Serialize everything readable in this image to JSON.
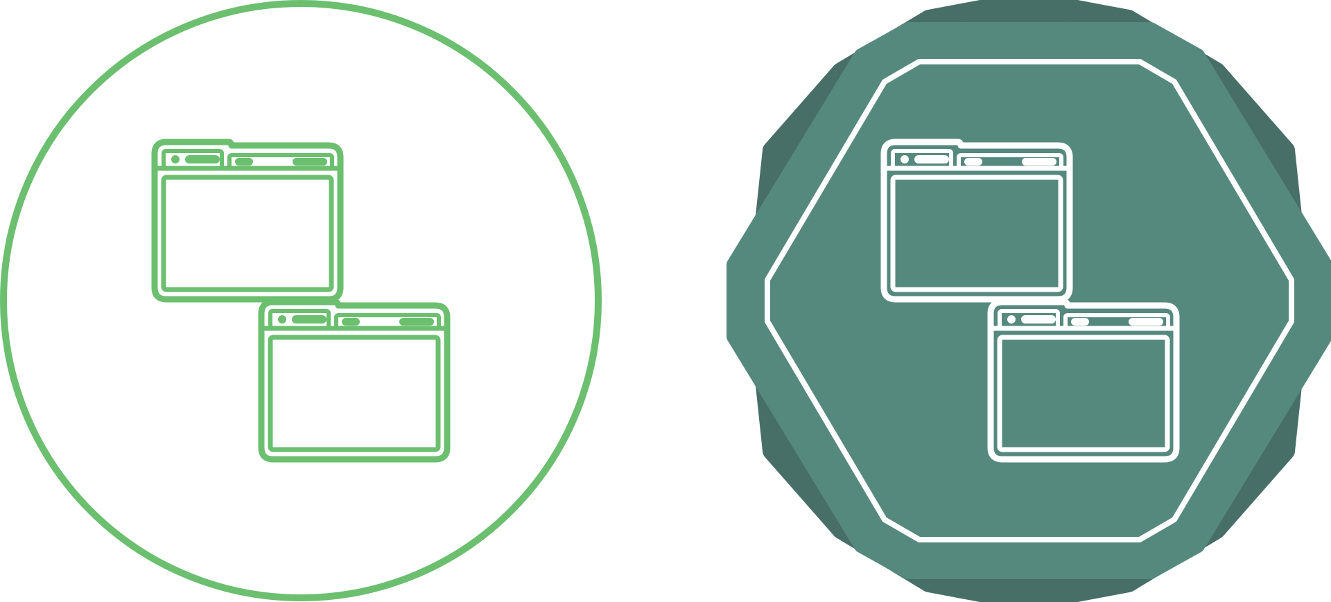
{
  "icons": {
    "outline_variant": {
      "icon": "browser-windows-icon",
      "stroke_color": "#6BBF6F",
      "background_color": "#ffffff"
    },
    "badge_variant": {
      "icon": "browser-windows-icon",
      "badge_shape": "octagon-badge",
      "badge_dark_color": "#476F67",
      "badge_color": "#56897D",
      "stroke_color": "#ffffff"
    }
  }
}
